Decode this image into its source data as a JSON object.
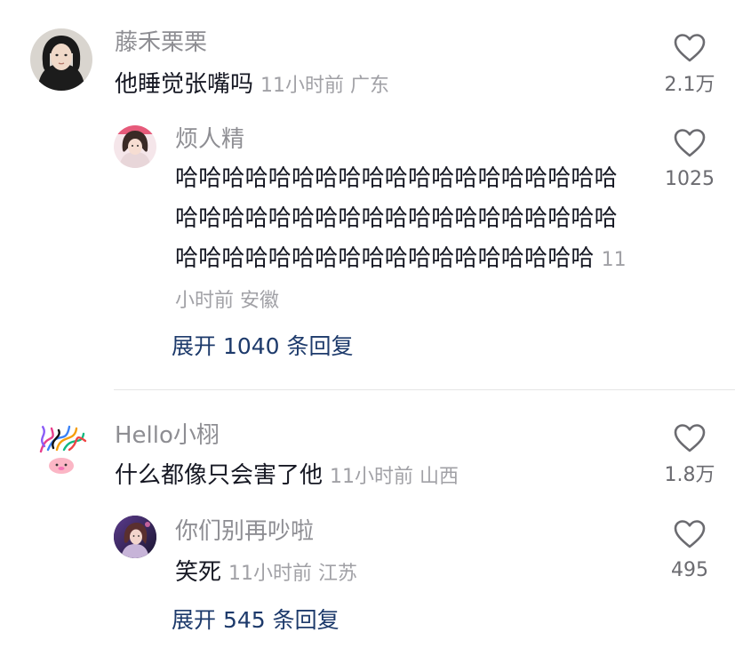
{
  "comments": [
    {
      "username": "藤禾栗栗",
      "text": "他睡觉张嘴吗",
      "meta": "11小时前 广东",
      "likes": "2.1万",
      "replies": [
        {
          "username": "烦人精",
          "text": "哈哈哈哈哈哈哈哈哈哈哈哈哈哈哈哈哈哈哈哈哈哈哈哈哈哈哈哈哈哈哈哈哈哈哈哈哈哈哈哈哈哈哈哈哈哈哈哈哈哈哈哈哈哈哈哈",
          "meta": "11小时前 安徽",
          "likes": "1025"
        }
      ],
      "expand_label": "展开 1040 条回复"
    },
    {
      "username": "Hello小栩",
      "text": "什么都像只会害了他",
      "meta": "11小时前 山西",
      "likes": "1.8万",
      "replies": [
        {
          "username": "你们别再吵啦",
          "text": "笑死",
          "meta": "11小时前 江苏",
          "likes": "495"
        }
      ],
      "expand_label": "展开 545 条回复"
    }
  ],
  "icons": {
    "like": "heart-outline-icon"
  },
  "colors": {
    "username": "#8e8e93",
    "text": "#161823",
    "meta": "#a1a1a6",
    "expand": "#1d3a6b",
    "divider": "#e5e5e5"
  }
}
